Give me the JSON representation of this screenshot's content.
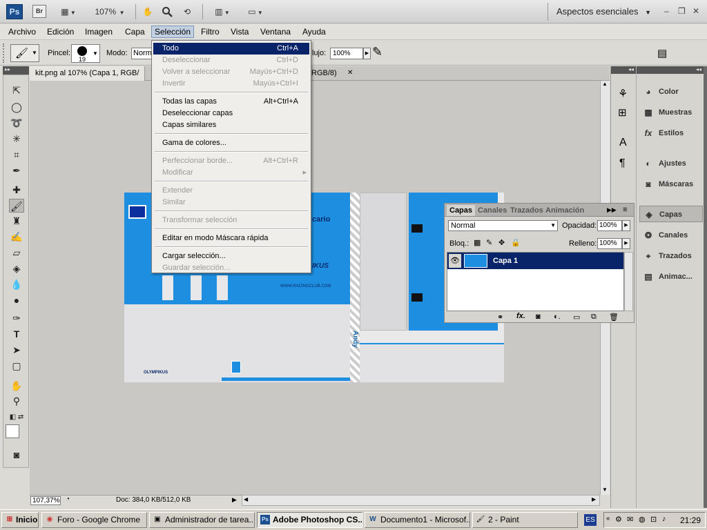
{
  "appbar": {
    "ps_label": "Ps",
    "br_label": "Br",
    "zoom": "107%",
    "workspace": "Aspectos esenciales",
    "win_min": "–",
    "win_restore": "❐",
    "win_close": "✕"
  },
  "menubar": [
    "Archivo",
    "Edición",
    "Imagen",
    "Capa",
    "Selección",
    "Filtro",
    "Vista",
    "Ventana",
    "Ayuda"
  ],
  "options": {
    "brush_label": "Pincel:",
    "brush_size": "19",
    "mode_label": "Modo:",
    "mode_value": "Norm",
    "flow_label": "lujo:",
    "flow_value": "100%"
  },
  "document": {
    "tab_title": "kit.png al 107% (Capa 1, RGB/",
    "tab_suffix": "RGB/8)",
    "close": "✕",
    "zoom_status": "107,37%",
    "doc_info": "Doc: 384,0 KB/512,0 KB"
  },
  "kit": {
    "sponsor": "OLYMPIKUS",
    "text_cario": "cario",
    "text_kus": "IKUS",
    "website": "WWW.RACINGCLUB.COM",
    "player_name": "Andy",
    "blue": "#1e8fe0"
  },
  "selection_menu": [
    {
      "label": "Todo",
      "shortcut": "Ctrl+A",
      "state": "highlight"
    },
    {
      "label": "Deseleccionar",
      "shortcut": "Ctrl+D",
      "state": "disabled"
    },
    {
      "label": "Volver a seleccionar",
      "shortcut": "Mayús+Ctrl+D",
      "state": "disabled"
    },
    {
      "label": "Invertir",
      "shortcut": "Mayús+Ctrl+I",
      "state": "disabled"
    },
    {
      "sep": true
    },
    {
      "label": "Todas las capas",
      "shortcut": "Alt+Ctrl+A",
      "state": "normal"
    },
    {
      "label": "Deseleccionar capas",
      "shortcut": "",
      "state": "normal"
    },
    {
      "label": "Capas similares",
      "shortcut": "",
      "state": "normal"
    },
    {
      "sep": true
    },
    {
      "label": "Gama de colores...",
      "shortcut": "",
      "state": "normal"
    },
    {
      "sep": true
    },
    {
      "label": "Perfeccionar borde...",
      "shortcut": "Alt+Ctrl+R",
      "state": "disabled"
    },
    {
      "label": "Modificar",
      "shortcut": "▸",
      "state": "disabled"
    },
    {
      "sep": true
    },
    {
      "label": "Extender",
      "shortcut": "",
      "state": "disabled"
    },
    {
      "label": "Similar",
      "shortcut": "",
      "state": "disabled"
    },
    {
      "sep": true
    },
    {
      "label": "Transformar selección",
      "shortcut": "",
      "state": "disabled"
    },
    {
      "sep": true
    },
    {
      "label": "Editar en modo Máscara rápida",
      "shortcut": "",
      "state": "normal"
    },
    {
      "sep": true
    },
    {
      "label": "Cargar selección...",
      "shortcut": "",
      "state": "normal"
    },
    {
      "label": "Guardar selección...",
      "shortcut": "",
      "state": "disabled"
    }
  ],
  "layers_panel": {
    "tabs": [
      "Capas",
      "Canales",
      "Trazados",
      "Animación"
    ],
    "blend_mode": "Normal",
    "opacity_label": "Opacidad:",
    "opacity_value": "100%",
    "lock_label": "Bloq.:",
    "fill_label": "Relleno:",
    "fill_value": "100%",
    "layer_name": "Capa 1"
  },
  "right_panels": [
    {
      "label": "Color",
      "icon": "color-icon"
    },
    {
      "label": "Muestras",
      "icon": "swatches-icon"
    },
    {
      "label": "Estilos",
      "icon": "styles-icon"
    },
    {
      "label": "Ajustes",
      "icon": "adjustments-icon"
    },
    {
      "label": "Máscaras",
      "icon": "masks-icon"
    },
    {
      "label": "Capas",
      "icon": "layers-icon"
    },
    {
      "label": "Canales",
      "icon": "channels-icon"
    },
    {
      "label": "Trazados",
      "icon": "paths-icon"
    },
    {
      "label": "Animac...",
      "icon": "animation-icon"
    }
  ],
  "taskbar": {
    "start": "Inicio",
    "items": [
      {
        "label": "Foro - Google Chrome",
        "icon": "chrome-icon"
      },
      {
        "label": "Administrador de tarea...",
        "icon": "task-manager-icon"
      },
      {
        "label": "Adobe Photoshop CS...",
        "icon": "photoshop-icon"
      },
      {
        "label": "Documento1 - Microsof...",
        "icon": "word-icon"
      },
      {
        "label": "2 - Paint",
        "icon": "paint-icon"
      }
    ],
    "lang": "ES",
    "clock": "21:29"
  }
}
